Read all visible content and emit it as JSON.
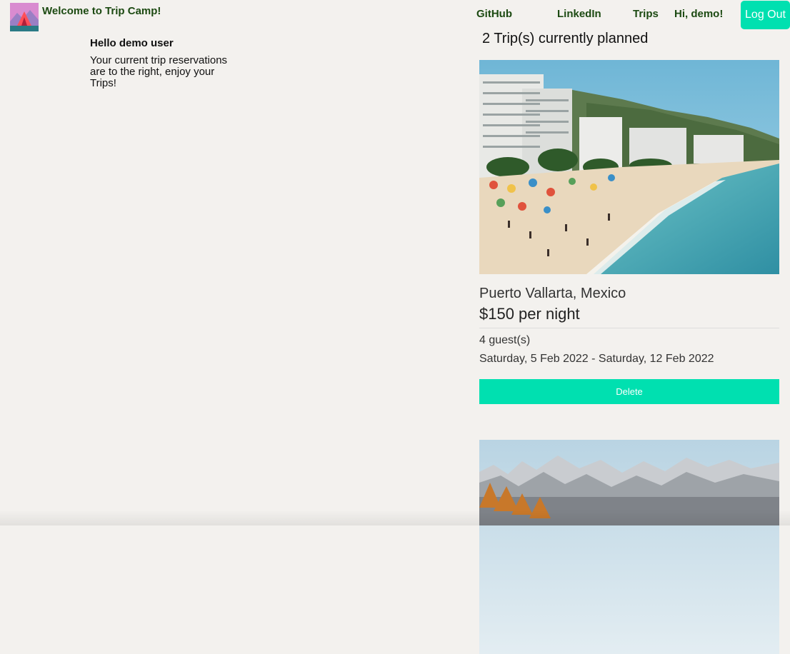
{
  "header": {
    "site_title": "Welcome to Trip Camp!",
    "nav": {
      "github": "GitHub",
      "linkedin": "LinkedIn",
      "trips": "Trips",
      "greeting": "Hi, demo!"
    },
    "logout_label": "Log Out",
    "accent_color": "#00e0b0",
    "nav_color": "#1c4a12"
  },
  "greeting": {
    "title": "Hello demo user",
    "message": "Your current trip reservations are to the right, enjoy your Trips!"
  },
  "trips": {
    "count_text": "2 Trip(s) currently planned",
    "items": [
      {
        "image": "beach-photo",
        "location": "Puerto Vallarta, Mexico",
        "price": "$150 per night",
        "guests": "4 guest(s)",
        "dates": "Saturday, 5 Feb 2022 - Saturday, 12 Feb 2022",
        "delete_label": "Delete"
      },
      {
        "image": "mountain-photo"
      }
    ]
  }
}
